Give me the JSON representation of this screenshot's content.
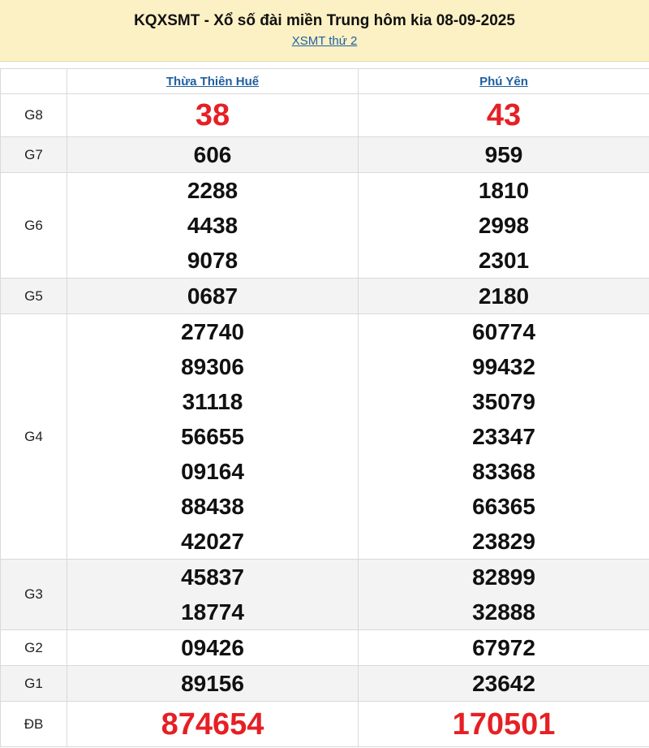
{
  "header": {
    "title": "KQXSMT - Xổ số đài miền Trung hôm kia 08-09-2025",
    "link_label": "XSMT thứ 2"
  },
  "provinces": [
    "Thừa Thiên Huế",
    "Phú Yên"
  ],
  "prizes": [
    {
      "label": "G8",
      "values": [
        [
          "38"
        ],
        [
          "43"
        ]
      ]
    },
    {
      "label": "G7",
      "values": [
        [
          "606"
        ],
        [
          "959"
        ]
      ]
    },
    {
      "label": "G6",
      "values": [
        [
          "2288",
          "4438",
          "9078"
        ],
        [
          "1810",
          "2998",
          "2301"
        ]
      ]
    },
    {
      "label": "G5",
      "values": [
        [
          "0687"
        ],
        [
          "2180"
        ]
      ]
    },
    {
      "label": "G4",
      "values": [
        [
          "27740",
          "89306",
          "31118",
          "56655",
          "09164",
          "88438",
          "42027"
        ],
        [
          "60774",
          "99432",
          "35079",
          "23347",
          "83368",
          "66365",
          "23829"
        ]
      ]
    },
    {
      "label": "G3",
      "values": [
        [
          "45837",
          "18774"
        ],
        [
          "82899",
          "32888"
        ]
      ]
    },
    {
      "label": "G2",
      "values": [
        [
          "09426"
        ],
        [
          "67972"
        ]
      ]
    },
    {
      "label": "G1",
      "values": [
        [
          "89156"
        ],
        [
          "23642"
        ]
      ]
    },
    {
      "label": "ĐB",
      "values": [
        [
          "874654"
        ],
        [
          "170501"
        ]
      ]
    }
  ],
  "colors": {
    "header_bg": "#fcf1c4",
    "link": "#1e5f9f",
    "highlight": "#e52025",
    "alt_row": "#f3f3f3"
  }
}
